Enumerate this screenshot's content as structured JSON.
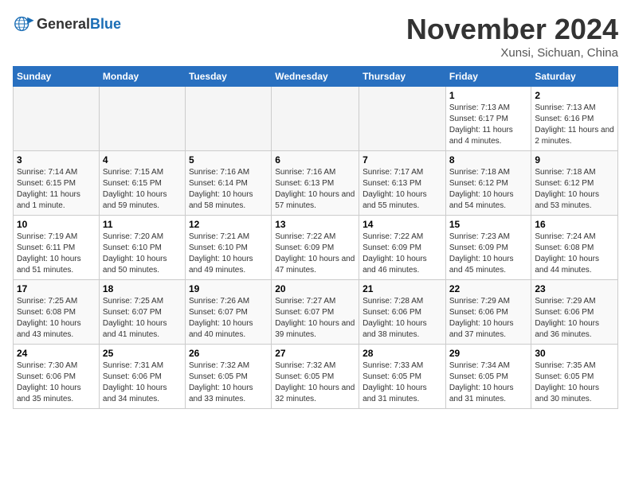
{
  "logo": {
    "text_general": "General",
    "text_blue": "Blue"
  },
  "header": {
    "month": "November 2024",
    "location": "Xunsi, Sichuan, China"
  },
  "weekdays": [
    "Sunday",
    "Monday",
    "Tuesday",
    "Wednesday",
    "Thursday",
    "Friday",
    "Saturday"
  ],
  "weeks": [
    [
      {
        "day": "",
        "empty": true
      },
      {
        "day": "",
        "empty": true
      },
      {
        "day": "",
        "empty": true
      },
      {
        "day": "",
        "empty": true
      },
      {
        "day": "",
        "empty": true
      },
      {
        "day": "1",
        "sunrise": "7:13 AM",
        "sunset": "6:17 PM",
        "daylight": "11 hours and 4 minutes."
      },
      {
        "day": "2",
        "sunrise": "7:13 AM",
        "sunset": "6:16 PM",
        "daylight": "11 hours and 2 minutes."
      }
    ],
    [
      {
        "day": "3",
        "sunrise": "7:14 AM",
        "sunset": "6:15 PM",
        "daylight": "11 hours and 1 minute."
      },
      {
        "day": "4",
        "sunrise": "7:15 AM",
        "sunset": "6:15 PM",
        "daylight": "10 hours and 59 minutes."
      },
      {
        "day": "5",
        "sunrise": "7:16 AM",
        "sunset": "6:14 PM",
        "daylight": "10 hours and 58 minutes."
      },
      {
        "day": "6",
        "sunrise": "7:16 AM",
        "sunset": "6:13 PM",
        "daylight": "10 hours and 57 minutes."
      },
      {
        "day": "7",
        "sunrise": "7:17 AM",
        "sunset": "6:13 PM",
        "daylight": "10 hours and 55 minutes."
      },
      {
        "day": "8",
        "sunrise": "7:18 AM",
        "sunset": "6:12 PM",
        "daylight": "10 hours and 54 minutes."
      },
      {
        "day": "9",
        "sunrise": "7:18 AM",
        "sunset": "6:12 PM",
        "daylight": "10 hours and 53 minutes."
      }
    ],
    [
      {
        "day": "10",
        "sunrise": "7:19 AM",
        "sunset": "6:11 PM",
        "daylight": "10 hours and 51 minutes."
      },
      {
        "day": "11",
        "sunrise": "7:20 AM",
        "sunset": "6:10 PM",
        "daylight": "10 hours and 50 minutes."
      },
      {
        "day": "12",
        "sunrise": "7:21 AM",
        "sunset": "6:10 PM",
        "daylight": "10 hours and 49 minutes."
      },
      {
        "day": "13",
        "sunrise": "7:22 AM",
        "sunset": "6:09 PM",
        "daylight": "10 hours and 47 minutes."
      },
      {
        "day": "14",
        "sunrise": "7:22 AM",
        "sunset": "6:09 PM",
        "daylight": "10 hours and 46 minutes."
      },
      {
        "day": "15",
        "sunrise": "7:23 AM",
        "sunset": "6:09 PM",
        "daylight": "10 hours and 45 minutes."
      },
      {
        "day": "16",
        "sunrise": "7:24 AM",
        "sunset": "6:08 PM",
        "daylight": "10 hours and 44 minutes."
      }
    ],
    [
      {
        "day": "17",
        "sunrise": "7:25 AM",
        "sunset": "6:08 PM",
        "daylight": "10 hours and 43 minutes."
      },
      {
        "day": "18",
        "sunrise": "7:25 AM",
        "sunset": "6:07 PM",
        "daylight": "10 hours and 41 minutes."
      },
      {
        "day": "19",
        "sunrise": "7:26 AM",
        "sunset": "6:07 PM",
        "daylight": "10 hours and 40 minutes."
      },
      {
        "day": "20",
        "sunrise": "7:27 AM",
        "sunset": "6:07 PM",
        "daylight": "10 hours and 39 minutes."
      },
      {
        "day": "21",
        "sunrise": "7:28 AM",
        "sunset": "6:06 PM",
        "daylight": "10 hours and 38 minutes."
      },
      {
        "day": "22",
        "sunrise": "7:29 AM",
        "sunset": "6:06 PM",
        "daylight": "10 hours and 37 minutes."
      },
      {
        "day": "23",
        "sunrise": "7:29 AM",
        "sunset": "6:06 PM",
        "daylight": "10 hours and 36 minutes."
      }
    ],
    [
      {
        "day": "24",
        "sunrise": "7:30 AM",
        "sunset": "6:06 PM",
        "daylight": "10 hours and 35 minutes."
      },
      {
        "day": "25",
        "sunrise": "7:31 AM",
        "sunset": "6:06 PM",
        "daylight": "10 hours and 34 minutes."
      },
      {
        "day": "26",
        "sunrise": "7:32 AM",
        "sunset": "6:05 PM",
        "daylight": "10 hours and 33 minutes."
      },
      {
        "day": "27",
        "sunrise": "7:32 AM",
        "sunset": "6:05 PM",
        "daylight": "10 hours and 32 minutes."
      },
      {
        "day": "28",
        "sunrise": "7:33 AM",
        "sunset": "6:05 PM",
        "daylight": "10 hours and 31 minutes."
      },
      {
        "day": "29",
        "sunrise": "7:34 AM",
        "sunset": "6:05 PM",
        "daylight": "10 hours and 31 minutes."
      },
      {
        "day": "30",
        "sunrise": "7:35 AM",
        "sunset": "6:05 PM",
        "daylight": "10 hours and 30 minutes."
      }
    ]
  ]
}
